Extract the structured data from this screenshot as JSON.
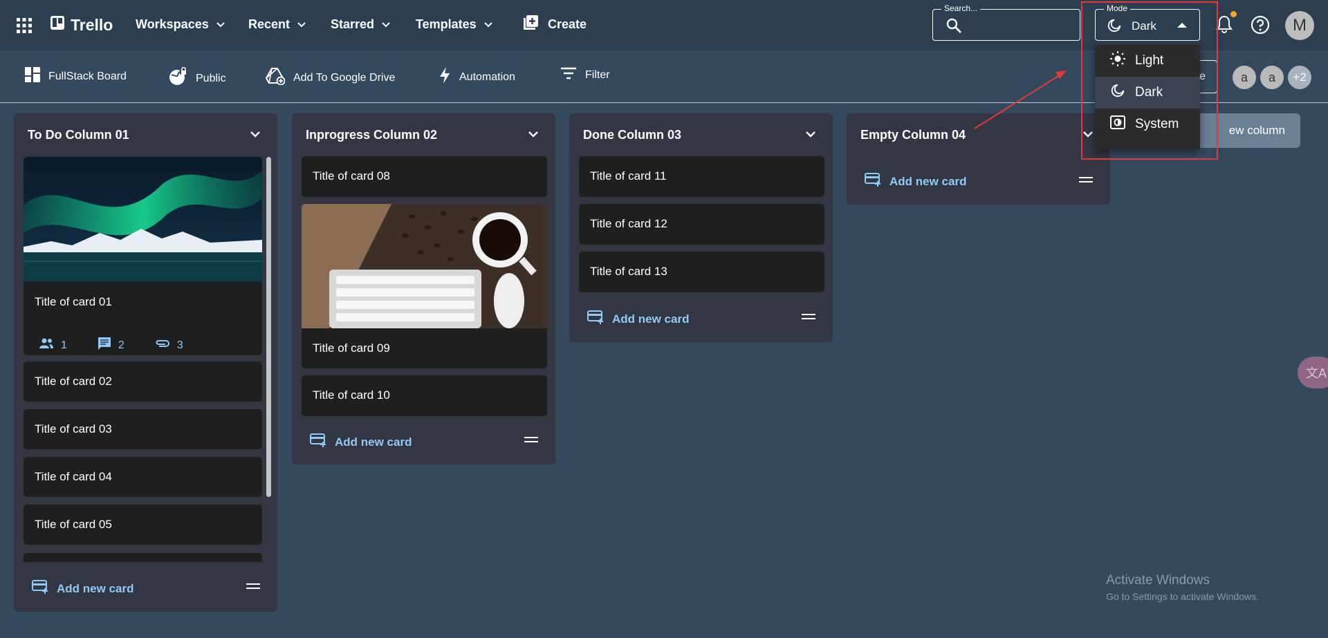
{
  "appbar": {
    "brand": "Trello",
    "nav": [
      {
        "label": "Workspaces"
      },
      {
        "label": "Recent"
      },
      {
        "label": "Starred"
      },
      {
        "label": "Templates"
      }
    ],
    "create_label": "Create",
    "search_label": "Search...",
    "search_value": "",
    "mode_label": "Mode",
    "mode_value": "Dark",
    "user_initial": "M",
    "notification_dot_color": "#f5a623"
  },
  "boardbar": {
    "board_name": "FullStack Board",
    "visibility": "Public",
    "drive": "Add To Google Drive",
    "automation": "Automation",
    "filter": "Filter",
    "invite_label": "e",
    "avatars": [
      "a",
      "a"
    ],
    "more_avatars": "+2"
  },
  "columns": [
    {
      "title": "To Do Column 01",
      "cards": [
        {
          "title": "Title of card 01",
          "members": "1",
          "comments": "2",
          "attachments": "3"
        },
        {
          "title": "Title of card 02"
        },
        {
          "title": "Title of card 03"
        },
        {
          "title": "Title of card 04"
        },
        {
          "title": "Title of card 05"
        }
      ],
      "add_label": "Add new card"
    },
    {
      "title": "Inprogress Column 02",
      "cards": [
        {
          "title": "Title of card 08"
        },
        {
          "title": "Title of card 09"
        },
        {
          "title": "Title of card 10"
        }
      ],
      "add_label": "Add new card"
    },
    {
      "title": "Done Column 03",
      "cards": [
        {
          "title": "Title of card 11"
        },
        {
          "title": "Title of card 12"
        },
        {
          "title": "Title of card 13"
        }
      ],
      "add_label": "Add new card"
    },
    {
      "title": "Empty Column 04",
      "cards": [],
      "add_label": "Add new card"
    }
  ],
  "add_column_label": "ew column",
  "mode_menu": {
    "items": [
      {
        "label": "Light",
        "icon": "sun-icon"
      },
      {
        "label": "Dark",
        "icon": "moon-icon",
        "selected": true
      },
      {
        "label": "System",
        "icon": "system-mode-icon"
      }
    ]
  },
  "translate_badge": "文A",
  "watermark": {
    "line1": "Activate Windows",
    "line2": "Go to Settings to activate Windows."
  },
  "colors": {
    "appbar": "#2c3e50",
    "board": "#34495e",
    "column": "#333643",
    "card": "#1f1f1f",
    "accent": "#90caf9",
    "annotation": "#e53935"
  }
}
